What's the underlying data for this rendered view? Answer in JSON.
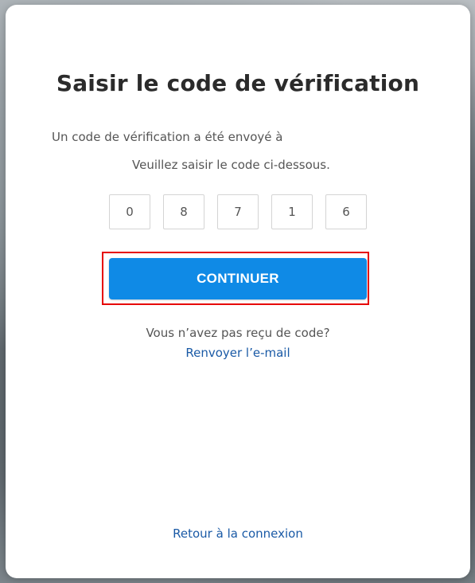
{
  "dialog": {
    "title": "Saisir le code de vérification",
    "sent_text": "Un code de vérification a été envoyé à",
    "instruction": "Veuillez saisir le code ci-dessous.",
    "code_digits": [
      "0",
      "8",
      "7",
      "1",
      "6"
    ],
    "continue_label": "CONTINUER",
    "no_code_text": "Vous n’avez pas reçu de code?",
    "resend_label": "Renvoyer l’e-mail",
    "back_label": "Retour à la connexion"
  },
  "colors": {
    "primary_button": "#0f8ae6",
    "link": "#1a5aa6",
    "highlight_border": "#e60000"
  }
}
